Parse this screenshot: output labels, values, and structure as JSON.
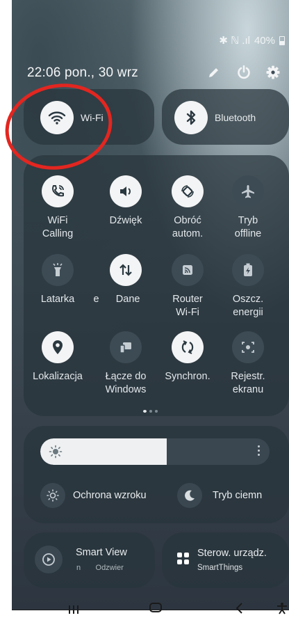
{
  "status": {
    "signal_icons": "✱ ℕ .ıl",
    "battery": "40%"
  },
  "header": {
    "time_date": "22:06  pon., 30 wrz"
  },
  "top_tiles": {
    "wifi": "Wi-Fi",
    "bluetooth": "Bluetooth"
  },
  "grid": [
    {
      "l1": "WiFi",
      "l2": "Calling"
    },
    {
      "l1": "Dźwięk",
      "l2": ""
    },
    {
      "l1": "Obróć",
      "l2": "autom."
    },
    {
      "l1": "Tryb",
      "l2": "offline"
    },
    {
      "l1": "Latarka",
      "l2": ""
    },
    {
      "l1": "e      Dane",
      "l2": ""
    },
    {
      "l1": "Router",
      "l2": "Wi-Fi"
    },
    {
      "l1": "Oszcz.",
      "l2": "energii"
    },
    {
      "l1": "Lokalizacja",
      "l2": ""
    },
    {
      "l1": "Łącze do",
      "l2": "Windows"
    },
    {
      "l1": "Synchron.",
      "l2": ""
    },
    {
      "l1": "Rejestr.",
      "l2": "ekranu"
    }
  ],
  "brightness": {
    "level": 0.55
  },
  "modes": {
    "eye": "Ochrona wzroku",
    "dark": "Tryb ciemn"
  },
  "bottom": {
    "smartview_title": "Smart View",
    "smartview_sub": "n       Odzwier",
    "devices_title": "Sterow. urządz.",
    "devices_sub": "SmartThings"
  }
}
